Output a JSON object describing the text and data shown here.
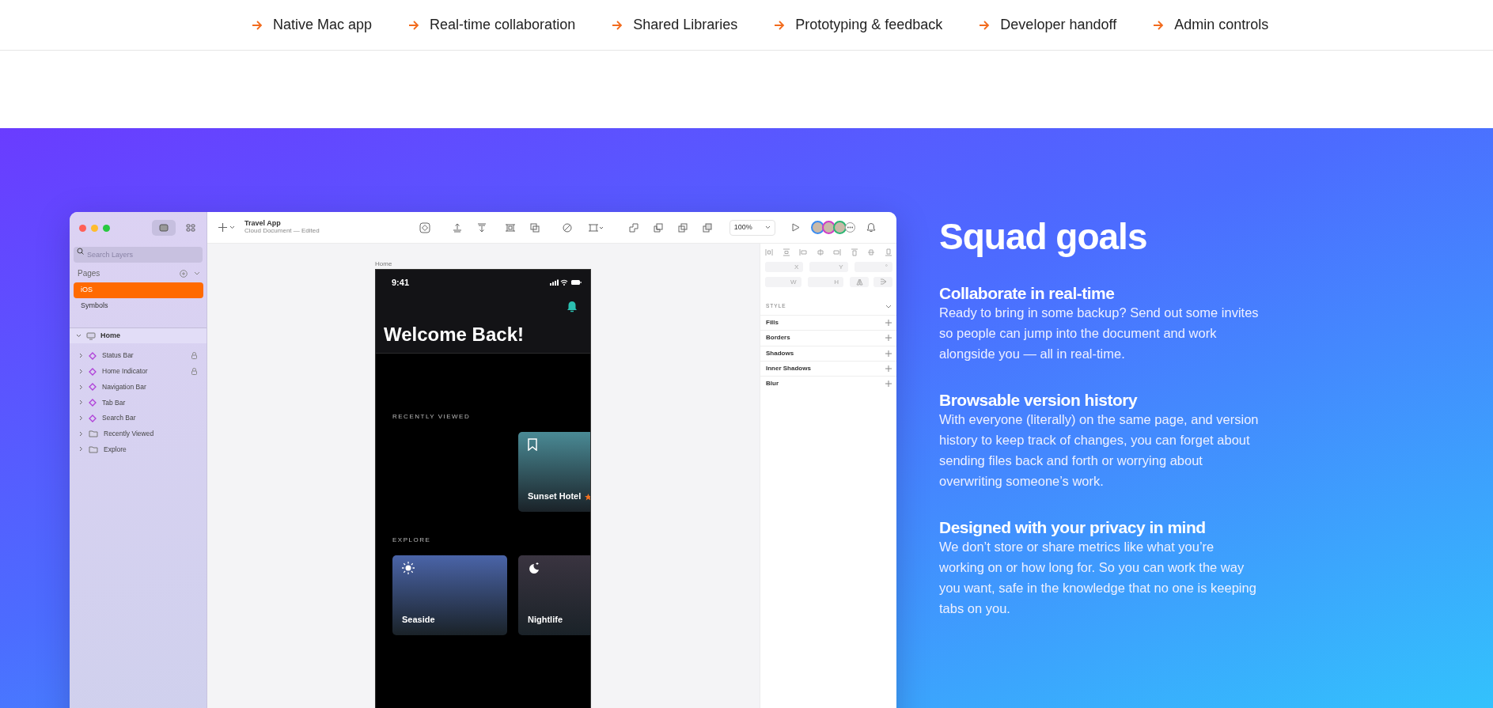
{
  "feature_nav": [
    {
      "label": "Native Mac app"
    },
    {
      "label": "Real-time collaboration"
    },
    {
      "label": "Shared Libraries"
    },
    {
      "label": "Prototyping & feedback"
    },
    {
      "label": "Developer handoff"
    },
    {
      "label": "Admin controls"
    }
  ],
  "app_window": {
    "sidebar": {
      "view_modes": [
        {
          "selected": true
        },
        {
          "selected": false
        }
      ],
      "search": {
        "placeholder": "Search Layers"
      },
      "pages_label": "Pages",
      "pages": [
        {
          "label": "iOS",
          "selected": true
        },
        {
          "label": "Symbols",
          "selected": false
        }
      ],
      "layers": [
        {
          "label": "Home",
          "kind": "artboard",
          "expanded": true,
          "selected": true,
          "children": [
            {
              "label": "Status Bar",
              "kind": "symbol",
              "expanded": false,
              "selected": false,
              "locked": true
            },
            {
              "label": "Home Indicator",
              "kind": "symbol",
              "expanded": false,
              "selected": false,
              "locked": true
            },
            {
              "label": "Navigation Bar",
              "kind": "symbol",
              "expanded": false,
              "selected": false,
              "locked": false
            },
            {
              "label": "Tab Bar",
              "kind": "symbol",
              "expanded": false,
              "selected": false,
              "locked": false
            },
            {
              "label": "Search Bar",
              "kind": "symbol",
              "expanded": false,
              "selected": false,
              "locked": false
            },
            {
              "label": "Recently Viewed",
              "kind": "group",
              "expanded": false,
              "selected": false,
              "locked": false
            },
            {
              "label": "Explore",
              "kind": "group",
              "expanded": false,
              "selected": false,
              "locked": false
            }
          ]
        }
      ]
    },
    "toolbar": {
      "document_title": "Travel App",
      "document_subtitle": "Cloud Document — Edited",
      "zoom": "100%",
      "collaborators": [
        {
          "color": "#3b8cf0"
        },
        {
          "color": "#d03cc8"
        },
        {
          "color": "#2bb673"
        }
      ]
    },
    "canvas": {
      "artboard_label": "Home",
      "phone": {
        "time": "9:41",
        "title": "Welcome Back!",
        "sections": [
          {
            "label": "RECENTLY VIEWED",
            "cards": [
              {
                "title": "Sunset Hotel",
                "kind": "hotel",
                "color": "#4a8a95",
                "offset": true
              }
            ]
          },
          {
            "label": "EXPLORE",
            "cards": [
              {
                "title": "Seaside",
                "kind": "sun",
                "color": "#4a64a8",
                "offset": false
              },
              {
                "title": "Nightlife",
                "kind": "moon",
                "color": "#3a3440",
                "offset": false
              }
            ]
          }
        ]
      }
    },
    "inspector": {
      "fields": [
        {
          "label": "X"
        },
        {
          "label": "Y"
        },
        {
          "label": "°"
        },
        {
          "label": "W"
        },
        {
          "label": "H"
        }
      ],
      "style_label": "STYLE",
      "sections": [
        {
          "label": "Fills"
        },
        {
          "label": "Borders"
        },
        {
          "label": "Shadows"
        },
        {
          "label": "Inner Shadows"
        },
        {
          "label": "Blur"
        }
      ]
    }
  },
  "info": {
    "title": "Squad goals",
    "features": [
      {
        "heading": "Collaborate in real-time",
        "body": "Ready to bring in some backup? Send out some invites so people can jump into the document and work alongside you — all in real-time."
      },
      {
        "heading": "Browsable version history",
        "body": "With everyone (literally) on the same page, and version history to keep track of changes, you can forget about sending files back and forth or worrying about overwriting someone’s work."
      },
      {
        "heading": "Designed with your privacy in mind",
        "body": "We don’t store or share metrics like what you’re working on or how long for. So you can work the way you want, safe in the knowledge that no one is keeping tabs on you."
      }
    ]
  }
}
